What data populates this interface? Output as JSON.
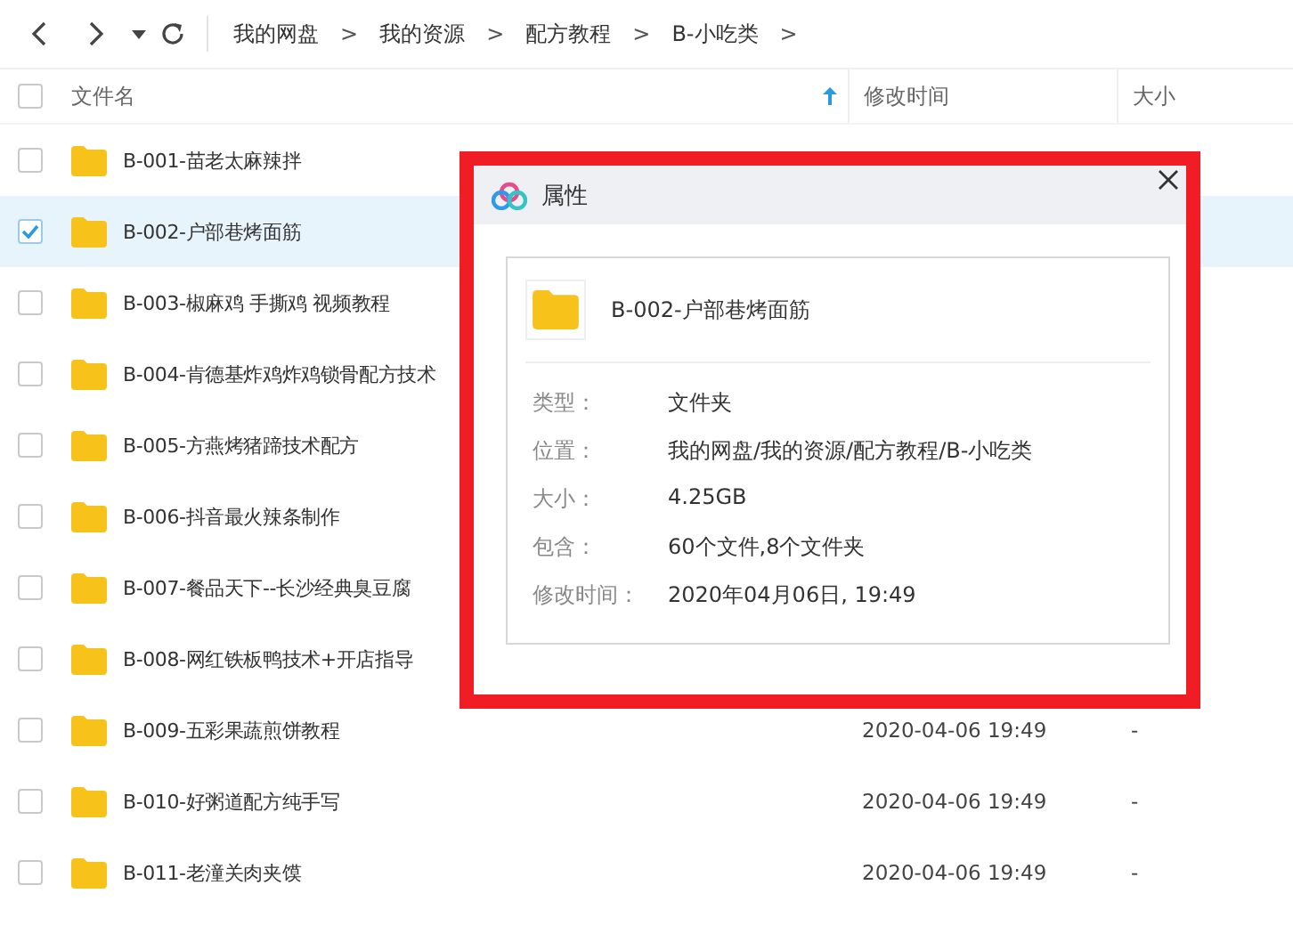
{
  "toolbar": {
    "breadcrumbs": [
      "我的网盘",
      "我的资源",
      "配方教程",
      "B-小吃类"
    ],
    "separator": ">"
  },
  "table": {
    "select_all_checked": false,
    "columns": [
      {
        "label": "文件名",
        "sorted": true
      },
      {
        "label": "修改时间",
        "sorted": false
      },
      {
        "label": "大小",
        "sorted": false
      }
    ],
    "rows": [
      {
        "name": "B-001-苗老太麻辣拌",
        "modified": "",
        "size": "",
        "selected": false
      },
      {
        "name": "B-002-户部巷烤面筋",
        "modified": "",
        "size": "",
        "selected": true
      },
      {
        "name": "B-003-椒麻鸡 手撕鸡 视频教程",
        "modified": "",
        "size": "",
        "selected": false
      },
      {
        "name": "B-004-肯德基炸鸡炸鸡锁骨配方技术",
        "modified": "",
        "size": "",
        "selected": false
      },
      {
        "name": "B-005-方燕烤猪蹄技术配方",
        "modified": "",
        "size": "",
        "selected": false
      },
      {
        "name": "B-006-抖音最火辣条制作",
        "modified": "",
        "size": "",
        "selected": false
      },
      {
        "name": "B-007-餐品天下--长沙经典臭豆腐",
        "modified": "",
        "size": "",
        "selected": false
      },
      {
        "name": "B-008-网红铁板鸭技术+开店指导",
        "modified": "",
        "size": "",
        "selected": false
      },
      {
        "name": "B-009-五彩果蔬煎饼教程",
        "modified": "2020-04-06 19:49",
        "size": "-",
        "selected": false
      },
      {
        "name": "B-010-好粥道配方纯手写",
        "modified": "2020-04-06 19:49",
        "size": "-",
        "selected": false
      },
      {
        "name": "B-011-老潼关肉夹馍",
        "modified": "2020-04-06 19:49",
        "size": "-",
        "selected": false
      }
    ]
  },
  "dialog": {
    "title": "属性",
    "file_name": "B-002-户部巷烤面筋",
    "properties": [
      {
        "label": "类型：",
        "value": "文件夹"
      },
      {
        "label": "位置：",
        "value": "我的网盘/我的资源/配方教程/B-小吃类"
      },
      {
        "label": "大小：",
        "value": "4.25GB"
      },
      {
        "label": "包含：",
        "value": "60个文件,8个文件夹"
      },
      {
        "label": "修改时间：",
        "value": "2020年04月06日, 19:49"
      }
    ]
  }
}
